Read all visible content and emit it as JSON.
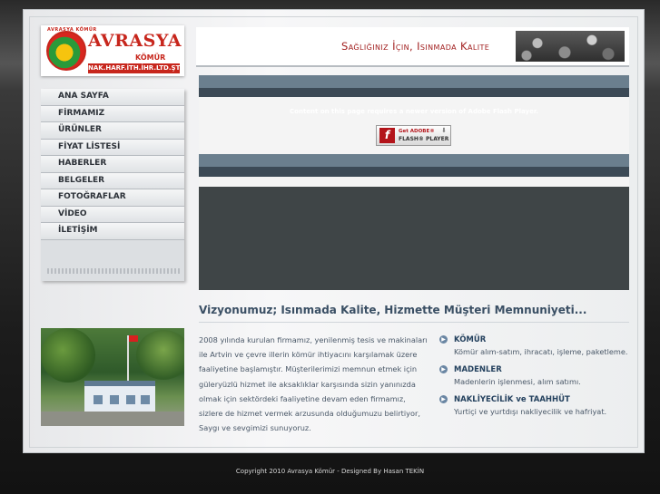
{
  "logo": {
    "arc_text": "AVRASYA KÖMÜR",
    "brand": "AVRASYA",
    "sub": "KÖMÜR",
    "banner": "NAK.HARF.İTH.İHR.LTD.ŞTİ."
  },
  "header": {
    "slogan": "Sağlığınız İçin, Isınmada Kalite"
  },
  "menu": {
    "items": [
      "ANA SAYFA",
      "FİRMAMIZ",
      "ÜRÜNLER",
      "FİYAT LİSTESİ",
      "HABERLER",
      "BELGELER",
      "FOTOĞRAFLAR",
      "VİDEO",
      "İLETİŞİM"
    ]
  },
  "flash": {
    "message": "Content on this page requires a newer version of Adobe Flash Player.",
    "button_line1": "Get ADOBE®",
    "button_line2": "FLASH® PLAYER"
  },
  "vision": {
    "title": "Vizyonumuz; Isınmada Kalite, Hizmette Müşteri Memnuniyeti..."
  },
  "about": {
    "text": "2008 yılında kurulan firmamız, yenilenmiş tesis ve makinaları ile Artvin ve çevre illerin kömür ihtiyacını karşılamak üzere faaliyetine başlamıştır. Müşterilerimizi memnun etmek için güleryüzlü hizmet ile aksaklıklar karşısında sizin yanınızda olmak için sektördeki faaliyetine devam eden firmamız, sizlere de hizmet vermek arzusunda olduğumuzu belirtiyor, Saygı ve sevgimizi sunuyoruz."
  },
  "services": [
    {
      "title": "KÖMÜR",
      "desc": "Kömür alım-satım, ihracatı, işleme, paketleme."
    },
    {
      "title": "MADENLER",
      "desc": "Madenlerin işlenmesi, alım satımı."
    },
    {
      "title": "NAKLİYECİLİK ve TAAHHÜT",
      "desc": "Yurtiçi ve yurtdışı nakliyecilik ve hafriyat."
    }
  ],
  "footer": {
    "text": "Copyright 2010 Avrasya Kömür - Designed By Hasan TEKİN"
  }
}
